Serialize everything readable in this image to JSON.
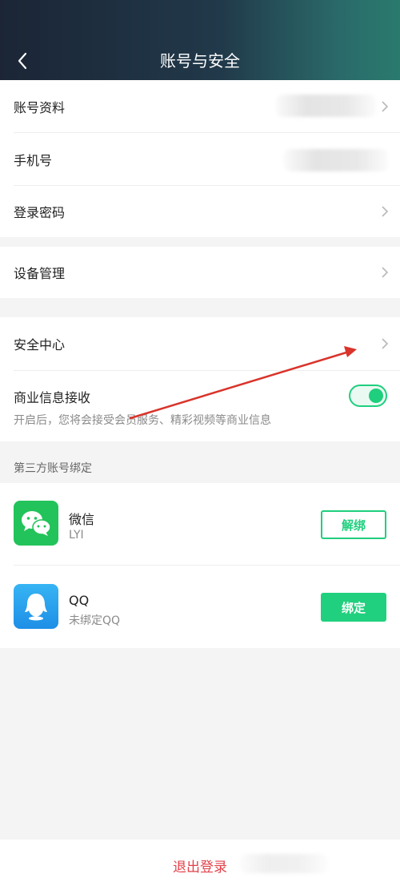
{
  "header": {
    "title": "账号与安全",
    "back_icon": "chevron-left-icon"
  },
  "account": {
    "profile_label": "账号资料",
    "phone_label": "手机号",
    "password_label": "登录密码"
  },
  "device": {
    "manage_label": "设备管理"
  },
  "security": {
    "center_label": "安全中心",
    "commercial_label": "商业信息接收",
    "commercial_desc": "开启后，您将会接受会员服务、精彩视频等商业信息",
    "commercial_enabled": true
  },
  "third_party": {
    "caption": "第三方账号绑定",
    "wechat": {
      "name": "微信",
      "account": "LYI",
      "action": "解绑"
    },
    "qq": {
      "name": "QQ",
      "account": "未绑定QQ",
      "action": "绑定"
    }
  },
  "footer": {
    "logout_label": "退出登录"
  },
  "colors": {
    "accent_green": "#1fcf7e",
    "danger_red": "#e2424a",
    "annotation_arrow": "#d9342b",
    "qq_blue": "#2aa5f0",
    "wechat_green": "#22c35a"
  }
}
